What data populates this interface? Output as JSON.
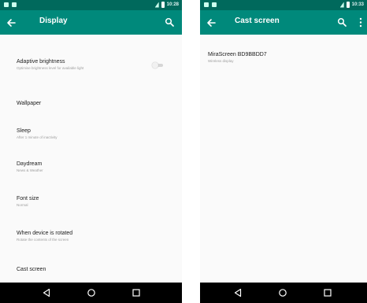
{
  "colors": {
    "status_bar": "#00695c",
    "app_bar": "#00897b",
    "nav_bar": "#000000",
    "background": "#fafafa"
  },
  "left_screen": {
    "status_time": "10:28",
    "title": "Display",
    "icons": [
      "back-arrow-icon",
      "search-icon"
    ],
    "items": [
      {
        "title": "Adaptive brightness",
        "subtitle": "Optimise brightness level for available light",
        "toggle": false
      },
      {
        "title": "Wallpaper",
        "subtitle": ""
      },
      {
        "title": "Sleep",
        "subtitle": "After 1 minute of inactivity"
      },
      {
        "title": "Daydream",
        "subtitle": "News & Weather"
      },
      {
        "title": "Font size",
        "subtitle": "Normal"
      },
      {
        "title": "When device is rotated",
        "subtitle": "Rotate the contents of the screen"
      },
      {
        "title": "Cast screen",
        "subtitle": ""
      }
    ]
  },
  "right_screen": {
    "status_time": "10:33",
    "title": "Cast screen",
    "icons": [
      "back-arrow-icon",
      "search-icon",
      "more-vert-icon"
    ],
    "devices": [
      {
        "name": "MiraScreen BD9BBDD7",
        "type": "Wireless display"
      }
    ]
  },
  "nav_bar": {
    "icons": [
      "back-triangle-icon",
      "home-circle-icon",
      "recents-square-icon"
    ]
  }
}
